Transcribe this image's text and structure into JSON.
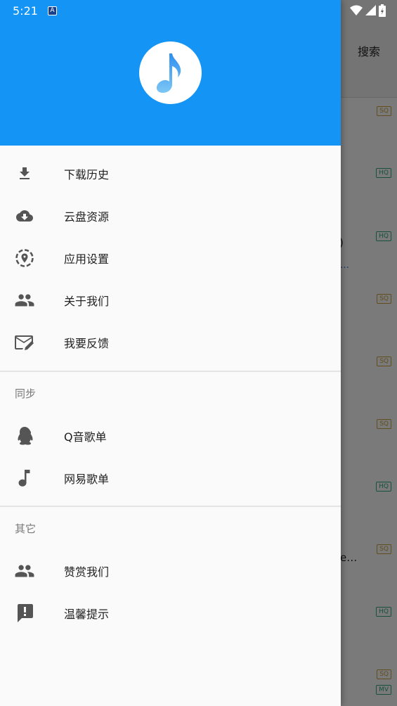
{
  "status_bar": {
    "time": "5:21",
    "notif_icon": "A"
  },
  "background": {
    "search_label": "搜索",
    "fragments": [
      {
        "text": ":)",
        "kind": "text"
      },
      {
        "text": "…",
        "kind": "link"
      },
      {
        "text": "e…",
        "kind": "text"
      }
    ],
    "badges": [
      "SQ",
      "HQ",
      "HQ",
      "SQ",
      "SQ",
      "SQ",
      "HQ",
      "SQ",
      "HQ",
      "SQ",
      "MV"
    ]
  },
  "drawer": {
    "header_color": "#1495f6",
    "logo_icon": "music-note-icon",
    "main_items": [
      {
        "label": "下载历史",
        "icon": "download-icon"
      },
      {
        "label": "云盘资源",
        "icon": "cloud-download-icon"
      },
      {
        "label": "应用设置",
        "icon": "location-settings-icon"
      },
      {
        "label": "关于我们",
        "icon": "people-icon"
      },
      {
        "label": "我要反馈",
        "icon": "mail-edit-icon"
      }
    ],
    "sync_section": {
      "title": "同步",
      "items": [
        {
          "label": "Q音歌单",
          "icon": "qq-penguin-icon"
        },
        {
          "label": "网易歌单",
          "icon": "music-note-icon"
        }
      ]
    },
    "other_section": {
      "title": "其它",
      "items": [
        {
          "label": "赞赏我们",
          "icon": "people-icon"
        },
        {
          "label": "温馨提示",
          "icon": "feedback-alert-icon"
        }
      ]
    }
  }
}
